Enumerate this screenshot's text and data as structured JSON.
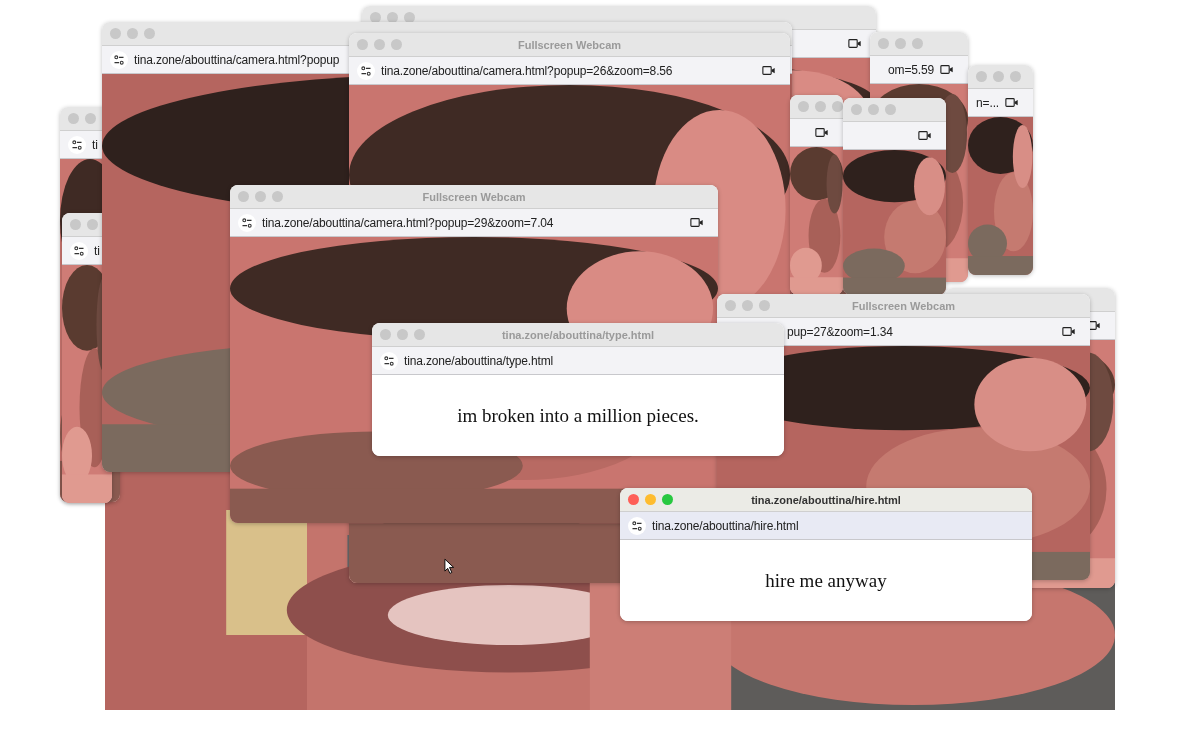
{
  "windows": [
    {
      "kind": "camera",
      "focused": false
    },
    {
      "kind": "camera",
      "focused": false,
      "url": "om=5.59"
    },
    {
      "kind": "camera",
      "focused": false,
      "url": "n=..."
    },
    {
      "kind": "camera",
      "focused": false,
      "url": "ti"
    },
    {
      "kind": "camera",
      "focused": false,
      "url": "ti"
    },
    {
      "kind": "camera",
      "focused": false,
      "url": "tina.zone/abouttina/camera.html?popup"
    },
    {
      "kind": "camera",
      "focused": false,
      "title": "Fullscreen Webcam",
      "url": "tina.zone/abouttina/camera.html?popup=26&zoom=8.56"
    },
    {
      "kind": "camera",
      "focused": false
    },
    {
      "kind": "camera",
      "focused": false
    },
    {
      "kind": "camera",
      "focused": false,
      "title": "Fullscreen Webcam",
      "url": "tina.zone/abouttina/camera.html?popup=29&zoom=7.04"
    },
    {
      "kind": "camera"
    },
    {
      "kind": "camera",
      "focused": false,
      "title": "Fullscreen Webcam",
      "url": "pup=27&zoom=1.34"
    },
    {
      "kind": "page",
      "focused": false,
      "title": "tina.zone/abouttina/type.html",
      "url": "tina.zone/abouttina/type.html",
      "text": "im broken into a million pieces."
    },
    {
      "kind": "page",
      "focused": true,
      "title": "tina.zone/abouttina/hire.html",
      "url": "tina.zone/abouttina/hire.html",
      "text": "hire me anyway"
    }
  ]
}
